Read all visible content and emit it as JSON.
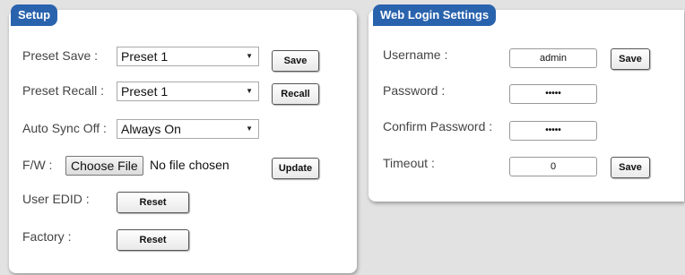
{
  "setup": {
    "title": "Setup",
    "preset_save": {
      "label": "Preset Save :",
      "value": "Preset 1",
      "button": "Save"
    },
    "preset_recall": {
      "label": "Preset Recall :",
      "value": "Preset 1",
      "button": "Recall"
    },
    "auto_sync": {
      "label": "Auto Sync Off :",
      "value": "Always On"
    },
    "firmware": {
      "label": "F/W :",
      "choose_button": "Choose File",
      "file_status": "No file chosen",
      "button": "Update"
    },
    "user_edid": {
      "label": "User EDID :",
      "button": "Reset"
    },
    "factory": {
      "label": "Factory :",
      "button": "Reset"
    }
  },
  "web_login": {
    "title": "Web Login Settings",
    "username": {
      "label": "Username :",
      "value": "admin",
      "button": "Save"
    },
    "password": {
      "label": "Password :",
      "value": "•••••"
    },
    "confirm_password": {
      "label": "Confirm Password :",
      "value": "•••••"
    },
    "timeout": {
      "label": "Timeout :",
      "value": "0",
      "button": "Save"
    }
  },
  "icons": {
    "dropdown": "dropdown-arrow-icon"
  },
  "colors": {
    "tab_background": "#2a63ad",
    "page_background": "#e2e2e2"
  }
}
